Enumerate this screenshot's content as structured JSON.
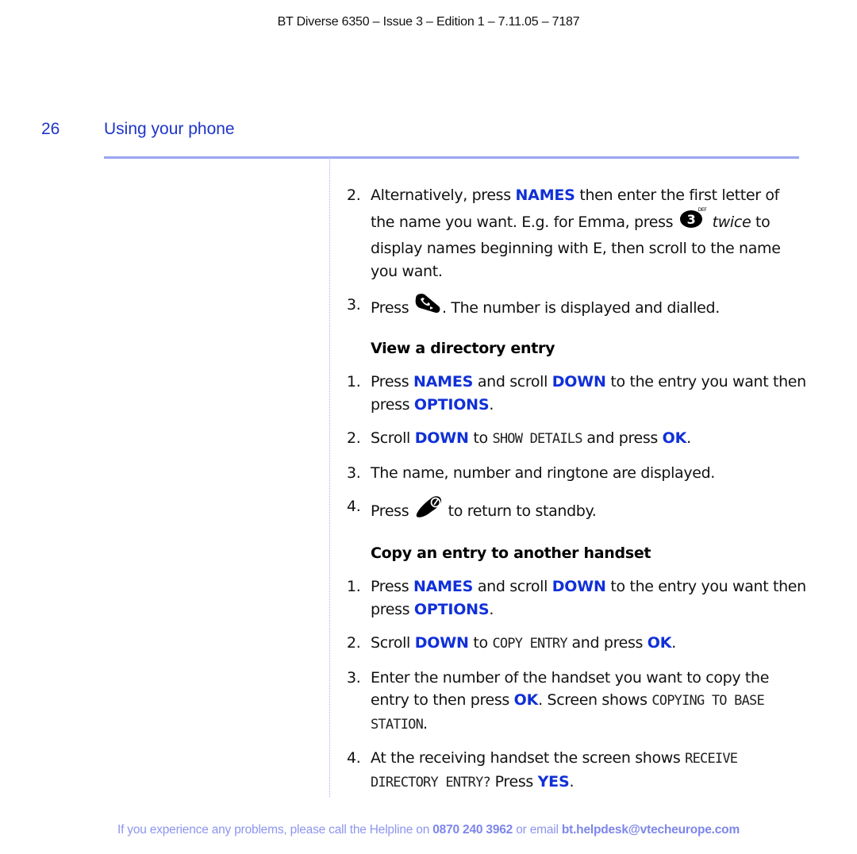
{
  "header": {
    "text": "BT Diverse 6350 – Issue 3 – Edition 1 – 7.11.05 – 7187"
  },
  "page": {
    "number": "26",
    "section_title": "Using your phone"
  },
  "intro_items": [
    {
      "num": "2.",
      "parts": {
        "a": "Alternatively, press ",
        "b": "NAMES",
        "c": " then enter the first letter of the name you want. E.g. for Emma, press ",
        "icon": "key-3-def-icon",
        "d": "twice",
        "e": " to display names beginning with E, then scroll to the name you want."
      }
    },
    {
      "num": "3.",
      "parts": {
        "a": "Press ",
        "icon": "talk-button-icon",
        "b": ". The number is displayed and dialled."
      }
    }
  ],
  "view_section": {
    "heading": "View a directory entry",
    "items": [
      {
        "num": "1.",
        "a": "Press ",
        "b": "NAMES",
        "c": " and scroll ",
        "d": "DOWN",
        "e": " to the entry you want then press ",
        "f": "OPTIONS",
        "g": "."
      },
      {
        "num": "2.",
        "a": "Scroll ",
        "b": "DOWN",
        "c": " to ",
        "d": "SHOW DETAILS",
        "e": " and press ",
        "f": "OK",
        "g": "."
      },
      {
        "num": "3.",
        "a": "The name, number and ringtone are displayed."
      },
      {
        "num": "4.",
        "a": "Press ",
        "icon": "end-call-button-icon",
        "b": " to return to standby."
      }
    ]
  },
  "copy_section": {
    "heading": "Copy an entry to another handset",
    "items": [
      {
        "num": "1.",
        "a": "Press ",
        "b": "NAMES",
        "c": " and scroll ",
        "d": "DOWN",
        "e": " to the entry you want then press ",
        "f": "OPTIONS",
        "g": "."
      },
      {
        "num": "2.",
        "a": "Scroll ",
        "b": "DOWN",
        "c": " to ",
        "d": "COPY ENTRY",
        "e": " and press ",
        "f": "OK",
        "g": "."
      },
      {
        "num": "3.",
        "a": "Enter the number of the handset you want to copy the entry to then press ",
        "b": "OK",
        "c": ". Screen shows ",
        "d": "COPYING TO BASE STATION",
        "e": "."
      },
      {
        "num": "4.",
        "a": "At the receiving handset the screen shows ",
        "b": "RECEIVE DIRECTORY ENTRY?",
        "c": " Press ",
        "d": "YES",
        "e": "."
      }
    ]
  },
  "footer": {
    "a": "If you experience any problems, please call the Helpline on ",
    "phone": "0870 240 3962",
    "b": " or email ",
    "email": "bt.helpdesk@vtecheurope.com"
  },
  "colors": {
    "accent": "#1030d8",
    "title": "#1e35c8",
    "rule": "#9aa6f2",
    "footer": "#8d95ee"
  }
}
